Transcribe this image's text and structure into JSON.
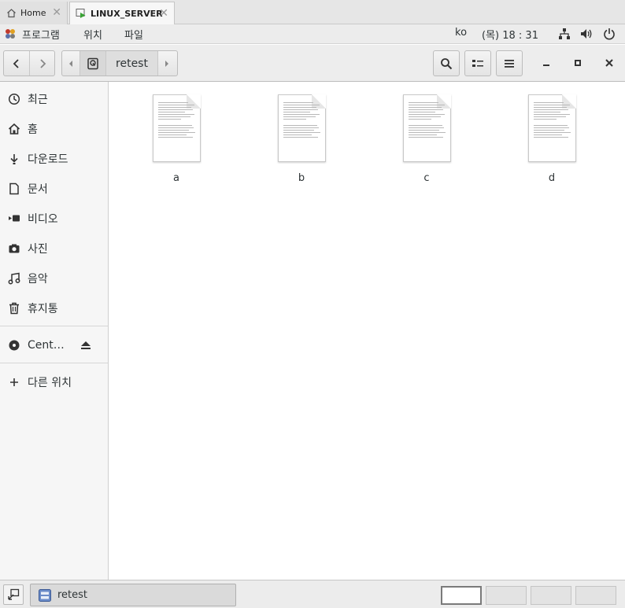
{
  "vm_tabs": [
    {
      "label": "Home",
      "icon": "home-icon"
    },
    {
      "label": "LINUX_SERVER",
      "icon": "vm-play-icon",
      "active": true
    }
  ],
  "top_panel": {
    "menus": [
      "프로그램",
      "위치",
      "파일"
    ],
    "input_language": "ko",
    "clock": "(목) 18 : 31",
    "status_icons": [
      "network-icon",
      "volume-icon",
      "power-icon"
    ]
  },
  "header": {
    "current_folder": "retest",
    "buttons": [
      "back",
      "forward",
      "search",
      "view-toggle",
      "menu",
      "minimize",
      "maximize",
      "close"
    ]
  },
  "sidebar": {
    "places": [
      {
        "label": "최근",
        "icon": "recent-icon"
      },
      {
        "label": "홈",
        "icon": "home-icon"
      },
      {
        "label": "다운로드",
        "icon": "download-icon"
      },
      {
        "label": "문서",
        "icon": "document-icon"
      },
      {
        "label": "비디오",
        "icon": "video-icon"
      },
      {
        "label": "사진",
        "icon": "camera-icon"
      },
      {
        "label": "음악",
        "icon": "music-icon"
      },
      {
        "label": "휴지통",
        "icon": "trash-icon"
      }
    ],
    "devices": [
      {
        "label": "Cent…",
        "icon": "optical-disc-icon"
      }
    ],
    "other": {
      "label": "다른 위치",
      "icon": "plus-icon"
    }
  },
  "files": [
    {
      "name": "a"
    },
    {
      "name": "b"
    },
    {
      "name": "c"
    },
    {
      "name": "d"
    }
  ],
  "taskbar": {
    "task_label": "retest",
    "workspaces": 4,
    "active_workspace": 1
  }
}
